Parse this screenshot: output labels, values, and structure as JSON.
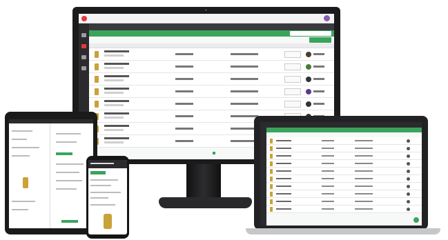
{
  "colors": {
    "accent_green": "#3aa45d",
    "brand_red": "#e23a3a",
    "dark_chrome": "#2b2b2e",
    "avatar_purple": "#8a5db5",
    "product_gold": "#c9a238"
  },
  "devices": [
    "desktop-monitor",
    "laptop",
    "tablet",
    "smartphone"
  ],
  "desktop": {
    "rail_icons": [
      "home-icon",
      "filter-icon",
      "chat-icon",
      "help-icon"
    ],
    "row_avatar_colors": [
      "#4a3d2d",
      "#4a7a3a",
      "#333333",
      "#5a3b8a",
      "#333333",
      "#333333",
      "#6a5bb0",
      "#333333"
    ]
  }
}
